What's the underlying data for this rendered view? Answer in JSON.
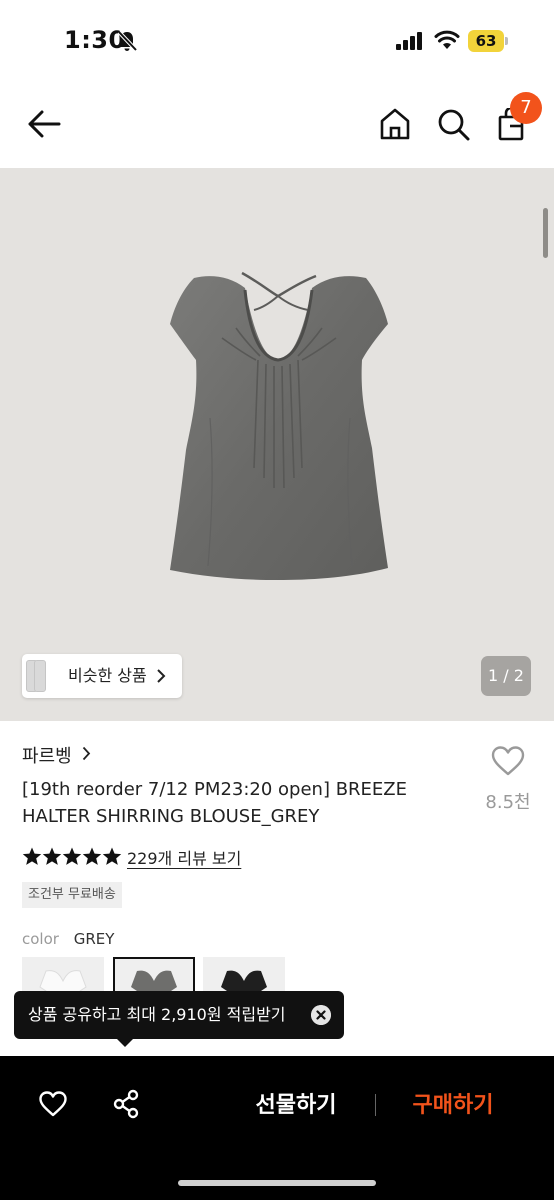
{
  "status_bar": {
    "time": "1:30",
    "battery_level": "63"
  },
  "header": {
    "cart_count": "7",
    "badge_color": "#f2531b"
  },
  "gallery": {
    "similar_products_label": "비슷한 상품",
    "page_indicator": "1 / 2",
    "background_color": "#e4e2df"
  },
  "product": {
    "brand": "파르벵",
    "title": "[19th reorder 7/12 PM23:20 open] BREEZE HALTER SHIRRING BLOUSE_GREY",
    "like_count": "8.5천",
    "rating_stars": 5,
    "review_link": "229개 리뷰 보기",
    "shipping_badge": "조건부 무료배송",
    "color_label": "color",
    "color_value": "GREY",
    "color_options": [
      {
        "name": "white",
        "color": "#f3f3f3",
        "selected": false
      },
      {
        "name": "grey",
        "color": "#6e6e6c",
        "selected": true
      },
      {
        "name": "black",
        "color": "#1f1f1f",
        "selected": false
      }
    ]
  },
  "share_tooltip": {
    "text": "상품 공유하고 최대 2,910원 적립받기"
  },
  "bottom_bar": {
    "gift_label": "선물하기",
    "buy_label": "구매하기",
    "buy_color": "#f2531b"
  },
  "icons": [
    "bell-slash-icon",
    "signal-icon",
    "wifi-icon",
    "back-arrow-icon",
    "home-icon",
    "search-icon",
    "shopping-bag-icon",
    "heart-icon",
    "share-icon",
    "close-icon",
    "star-icon",
    "chevron-right-icon"
  ]
}
